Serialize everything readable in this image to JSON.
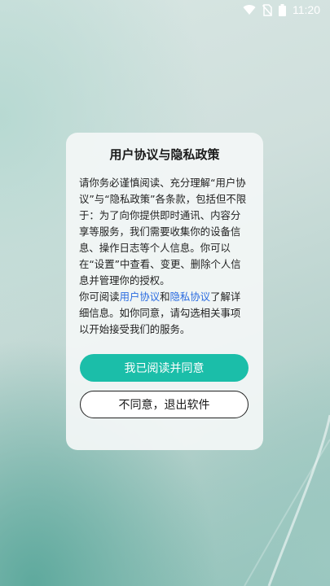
{
  "status_bar": {
    "time": "11:20",
    "icons": [
      "wifi-icon",
      "no-sim-icon",
      "battery-icon"
    ]
  },
  "dialog": {
    "title": "用户协议与隐私政策",
    "paragraph1": "请你务必谨慎阅读、充分理解“用户协议”与“隐私政策”各条款，包括但不限于：为了向你提供即时通讯、内容分享等服务，我们需要收集你的设备信息、操作日志等个人信息。你可以在“设置”中查看、变更、删除个人信息并管理你的授权。",
    "p2_prefix": "你可阅读",
    "link_user_agreement": "用户协议",
    "p2_and": "和",
    "link_privacy_agreement": "隐私协议",
    "p2_suffix": "了解详细信息。如你同意，请勾选相关事项以开始接受我们的服务。",
    "agree_button": "我已阅读并同意",
    "disagree_button": "不同意，退出软件"
  },
  "colors": {
    "accent": "#1bbea9",
    "link": "#2a6be0"
  }
}
